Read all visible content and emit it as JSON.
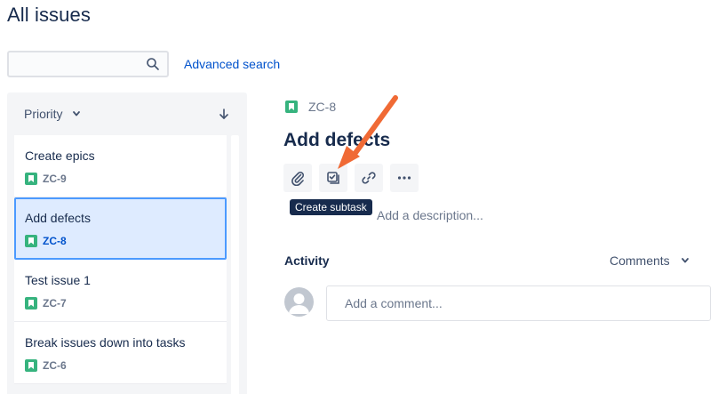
{
  "page": {
    "title": "All issues"
  },
  "search": {
    "value": "",
    "placeholder": "",
    "advanced_label": "Advanced search"
  },
  "sort": {
    "label": "Priority",
    "direction_icon": "arrow-down-icon"
  },
  "issues": [
    {
      "title": "Create epics",
      "key": "ZC-9",
      "selected": false
    },
    {
      "title": "Add defects",
      "key": "ZC-8",
      "selected": true
    },
    {
      "title": "Test issue 1",
      "key": "ZC-7",
      "selected": false
    },
    {
      "title": "Break issues down into tasks",
      "key": "ZC-6",
      "selected": false
    }
  ],
  "detail": {
    "key": "ZC-8",
    "title": "Add defects",
    "toolbar": [
      {
        "icon": "paperclip-icon",
        "label": "Attach"
      },
      {
        "icon": "subtask-icon",
        "label": "Create subtask"
      },
      {
        "icon": "link-icon",
        "label": "Link issue"
      },
      {
        "icon": "more-icon",
        "label": "More"
      }
    ],
    "tooltip": "Create subtask",
    "description_placeholder": "Add a description..."
  },
  "activity": {
    "label": "Activity",
    "filter": "Comments",
    "comment_placeholder": "Add a comment..."
  },
  "colors": {
    "accent": "#0052CC",
    "story_green": "#36B37E",
    "selected_bg": "#DEEBFF",
    "selected_border": "#4C9AFF",
    "annotation_arrow": "#F06A35"
  }
}
